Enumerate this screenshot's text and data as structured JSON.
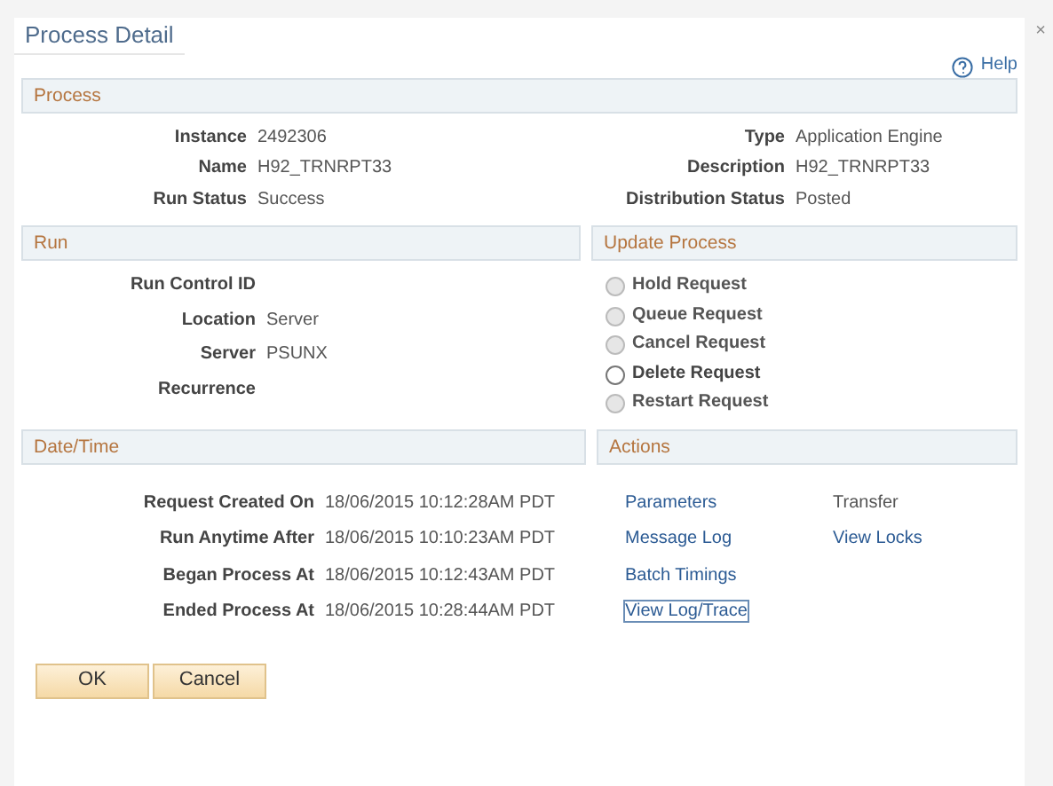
{
  "window": {
    "title": "Process Detail",
    "close": "×"
  },
  "help": {
    "label": "Help"
  },
  "process": {
    "title": "Process",
    "left": [
      {
        "label": "Instance",
        "value": "2492306"
      },
      {
        "label": "Name",
        "value": "H92_TRNRPT33"
      },
      {
        "label": "Run Status",
        "value": "Success"
      }
    ],
    "right": [
      {
        "label": "Type",
        "value": "Application Engine"
      },
      {
        "label": "Description",
        "value": "H92_TRNRPT33"
      },
      {
        "label": "Distribution Status",
        "value": "Posted"
      }
    ]
  },
  "run": {
    "title": "Run",
    "fields": [
      {
        "label": "Run Control ID"
      },
      {
        "label": "Location",
        "value": "Server"
      },
      {
        "label": "Server",
        "value": "PSUNX"
      },
      {
        "label": "Recurrence"
      }
    ]
  },
  "update_process": {
    "title": "Update Process",
    "options": [
      {
        "label": "Hold Request",
        "disabled": true,
        "selected": false
      },
      {
        "label": "Queue Request",
        "disabled": true,
        "selected": false
      },
      {
        "label": "Cancel Request",
        "disabled": true,
        "selected": false
      },
      {
        "label": "Delete Request",
        "disabled": false,
        "selected": false
      },
      {
        "label": "Restart Request",
        "disabled": true,
        "selected": false
      }
    ]
  },
  "date_time": {
    "title": "Date/Time",
    "fields": [
      {
        "label": "Request Created On",
        "value": "18/06/2015 10:12:28AM PDT"
      },
      {
        "label": "Run Anytime After",
        "value": "18/06/2015 10:10:23AM PDT"
      },
      {
        "label": "Began Process At",
        "value": "18/06/2015 10:12:43AM PDT"
      },
      {
        "label": "Ended Process At",
        "value": "18/06/2015 10:28:44AM PDT"
      }
    ]
  },
  "actions": {
    "title": "Actions",
    "items": [
      {
        "label": "Parameters",
        "kind": "link",
        "focused": false
      },
      {
        "label": "Message Log",
        "kind": "link",
        "focused": false
      },
      {
        "label": "Batch Timings",
        "kind": "link",
        "focused": false
      },
      {
        "label": "View Log/Trace",
        "kind": "link",
        "focused": true
      },
      {
        "label": "Transfer",
        "kind": "text",
        "focused": false
      },
      {
        "label": "View Locks",
        "kind": "link",
        "focused": false
      }
    ]
  },
  "buttons": [
    "OK",
    "Cancel"
  ]
}
